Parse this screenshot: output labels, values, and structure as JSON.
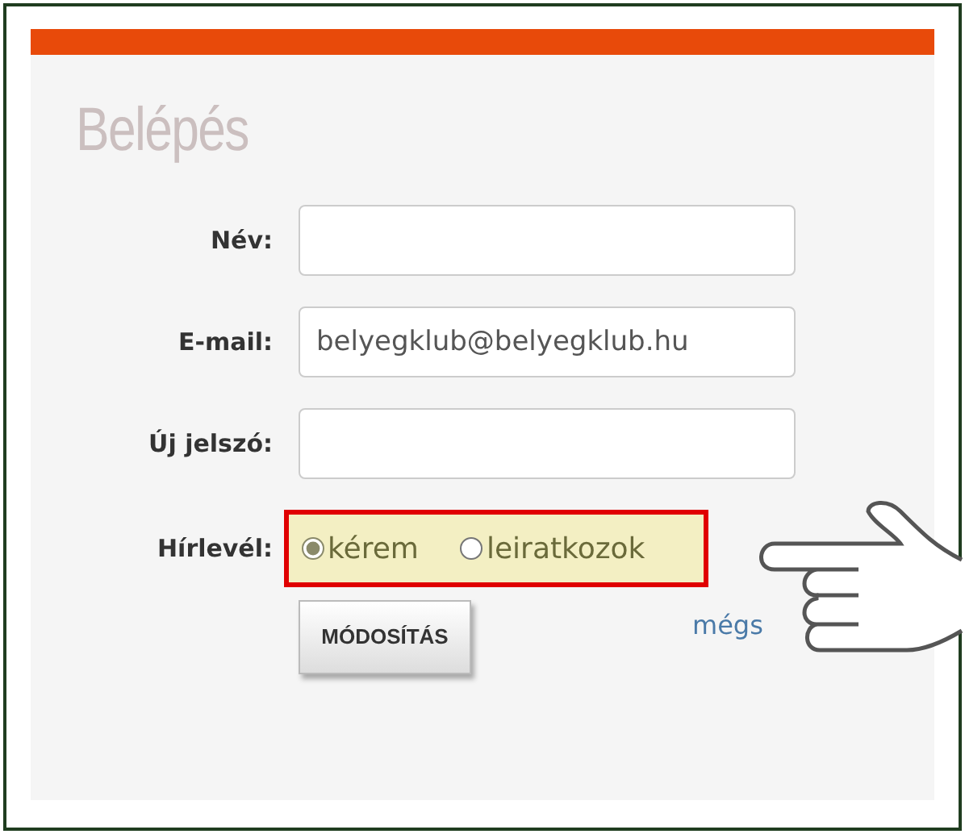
{
  "title": "Belépés",
  "fields": [
    {
      "label": "Név:"
    },
    {
      "label": "E-mail:",
      "value": "belyegklub@belyegklub.hu"
    },
    {
      "label": "Új jelszó:"
    }
  ],
  "newsletter": {
    "label": "Hírlevél:",
    "highlighted": true,
    "options": [
      {
        "label": "kérem",
        "selected": true
      },
      {
        "label": "leiratkozok",
        "selected": false
      }
    ]
  },
  "submit": "MÓDOSÍTÁS",
  "cancel_link": "mégs"
}
